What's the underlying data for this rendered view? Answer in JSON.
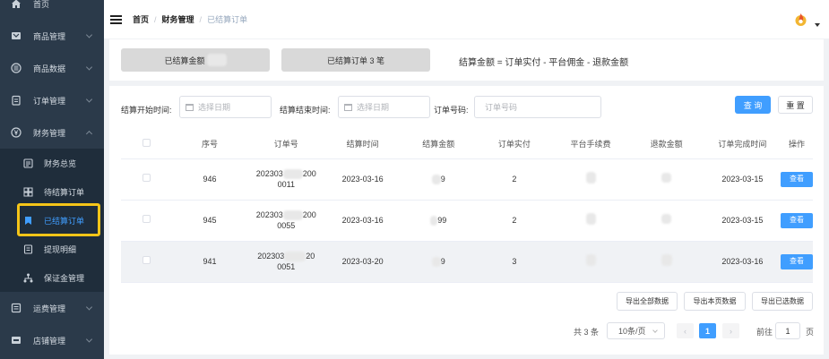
{
  "sidebar": {
    "items": [
      {
        "label": "首页"
      },
      {
        "label": "商品管理"
      },
      {
        "label": "商品数据"
      },
      {
        "label": "订单管理"
      },
      {
        "label": "财务管理"
      }
    ],
    "sub_items": [
      {
        "label": "财务总览"
      },
      {
        "label": "待结算订单"
      },
      {
        "label": "已结算订单"
      },
      {
        "label": "提现明细"
      },
      {
        "label": "保证金管理"
      }
    ],
    "bottom_items": [
      {
        "label": "运费管理"
      },
      {
        "label": "店铺管理"
      }
    ],
    "accent": "#409eff",
    "highlight_color": "#f5c518"
  },
  "header": {
    "breadcrumb": [
      "首页",
      "财务管理",
      "已结算订单"
    ],
    "separator": "/"
  },
  "summary": {
    "amount_btn": "已结算金额",
    "orders_btn": "已结算订单 3 笔",
    "formula": "结算金额 = 订单实付 - 平台佣金 - 退款金额"
  },
  "filters": {
    "start_label": "结算开始时间:",
    "start_placeholder": "选择日期",
    "end_label": "结算结束时间:",
    "end_placeholder": "选择日期",
    "order_label": "订单号码:",
    "order_placeholder": "订单号码",
    "search_btn": "查 询",
    "reset_btn": "重 置"
  },
  "table": {
    "columns": [
      "序号",
      "订单号",
      "结算时间",
      "结算金额",
      "订单实付",
      "平台手续费",
      "退款金额",
      "订单完成时间",
      "操作"
    ],
    "rows": [
      {
        "id": "946",
        "order_line1": "202303",
        "order_mid": "200",
        "order_line2": "0011",
        "settle_time": "2023-03-16",
        "amount": "9",
        "paid": "2",
        "finish_time": "2023-03-15",
        "action": "查看"
      },
      {
        "id": "945",
        "order_line1": "202303",
        "order_mid": "200",
        "order_line2": "0055",
        "settle_time": "2023-03-16",
        "amount": "99",
        "paid": "2",
        "finish_time": "2023-03-15",
        "action": "查看"
      },
      {
        "id": "941",
        "order_line1": "202303",
        "order_mid": "20",
        "order_line2": "0051",
        "settle_time": "2023-03-20",
        "amount": "9",
        "paid": "3",
        "finish_time": "2023-03-16",
        "action": "查看"
      }
    ]
  },
  "exports": {
    "all": "导出全部数据",
    "page": "导出本页数据",
    "selected": "导出已选数据"
  },
  "pagination": {
    "total": "共 3 条",
    "page_size": "10条/页",
    "current_page": "1",
    "goto_prefix": "前往",
    "goto_value": "1",
    "goto_suffix": "页",
    "prev": "‹",
    "next": "›"
  }
}
